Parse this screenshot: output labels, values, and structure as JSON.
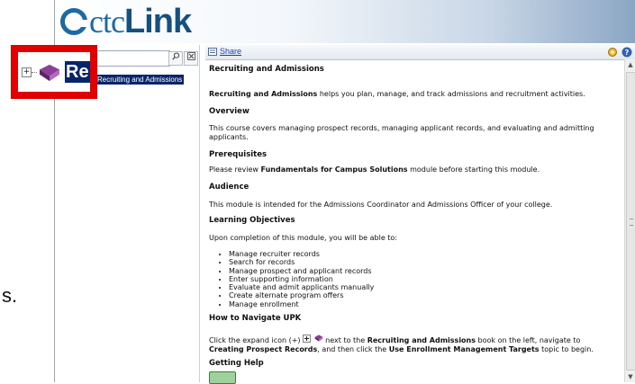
{
  "background_fragment": "s.",
  "app": {
    "logo_prefix": "ctc",
    "logo_suffix": "Link"
  },
  "left_panel": {
    "search_value": "",
    "tree": {
      "expand_symbol": "+",
      "label": "Recruiting and Admissions",
      "highlight_label": "Re"
    }
  },
  "toolbar": {
    "share_label": "Share"
  },
  "doc": {
    "title": "Recruiting and Admissions",
    "intro_bold": "Recruiting and Admissions",
    "intro_rest": " helps you plan, manage, and track admissions and recruitment activities.",
    "overview_heading": "Overview",
    "overview_text": "This course covers managing prospect records, managing applicant records, and evaluating and admitting applicants.",
    "prereq_heading": "Prerequisites",
    "prereq_pre": "Please review ",
    "prereq_bold": "Fundamentals for Campus Solutions",
    "prereq_post": " module before starting this module.",
    "audience_heading": "Audience",
    "audience_text": "This module is intended for the Admissions Coordinator and Admissions Officer of your college.",
    "objectives_heading": "Learning Objectives",
    "objectives_intro": "Upon completion of this module, you will be able to:",
    "objectives": [
      "Manage recruiter records",
      "Search for records",
      "Manage prospect and applicant records",
      "Enter supporting information",
      "Evaluate and admit applicants manually",
      "Create alternate program offers",
      "Manage enrollment"
    ],
    "navigate_heading": "How to Navigate UPK",
    "navigate_p1": "Click the expand icon (+) ",
    "navigate_p2": " next to the ",
    "navigate_bold1": "Recruiting and Admissions",
    "navigate_p3": " book on the left, navigate to ",
    "navigate_bold2": "Creating Prospect Records",
    "navigate_p4": ", and then click the ",
    "navigate_bold3": "Use Enrollment Management Targets",
    "navigate_p5": " topic to begin.",
    "help_heading": "Getting Help"
  },
  "colors": {
    "highlight_box": "#e00000",
    "selection": "#0a246a",
    "logo_blue": "#1c6aa3"
  }
}
